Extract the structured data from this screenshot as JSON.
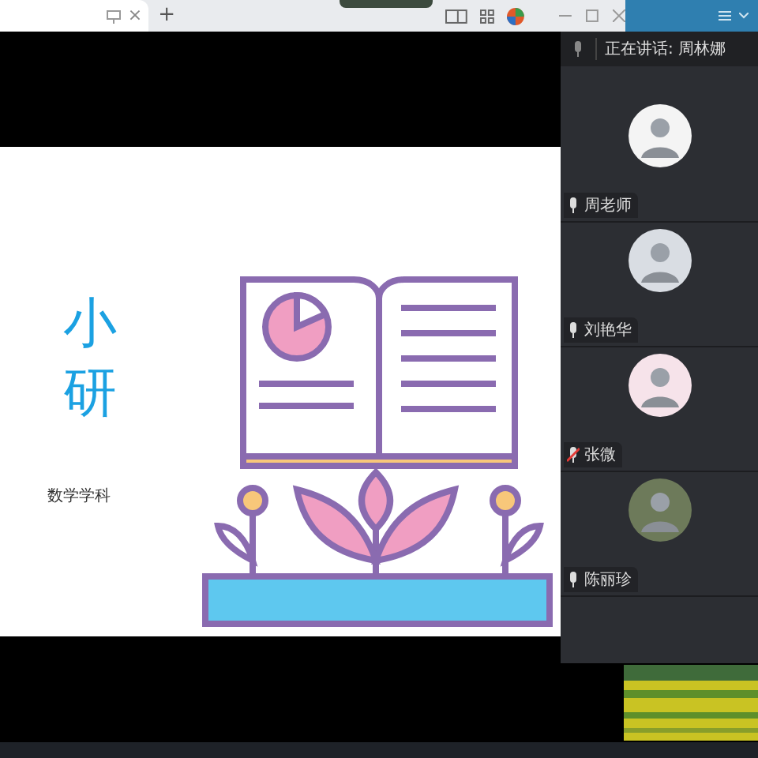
{
  "browser": {
    "tab_close": "×",
    "new_tab": "+"
  },
  "panel": {
    "speaking": "正在讲话: 周林娜",
    "participants": [
      {
        "name": "周老师",
        "muted": false
      },
      {
        "name": "刘艳华",
        "muted": false
      },
      {
        "name": "张微",
        "muted": true
      },
      {
        "name": "陈丽珍",
        "muted": false
      }
    ]
  },
  "slide": {
    "title_lines": [
      "小",
      "研"
    ],
    "subtitle": "数学学科"
  }
}
